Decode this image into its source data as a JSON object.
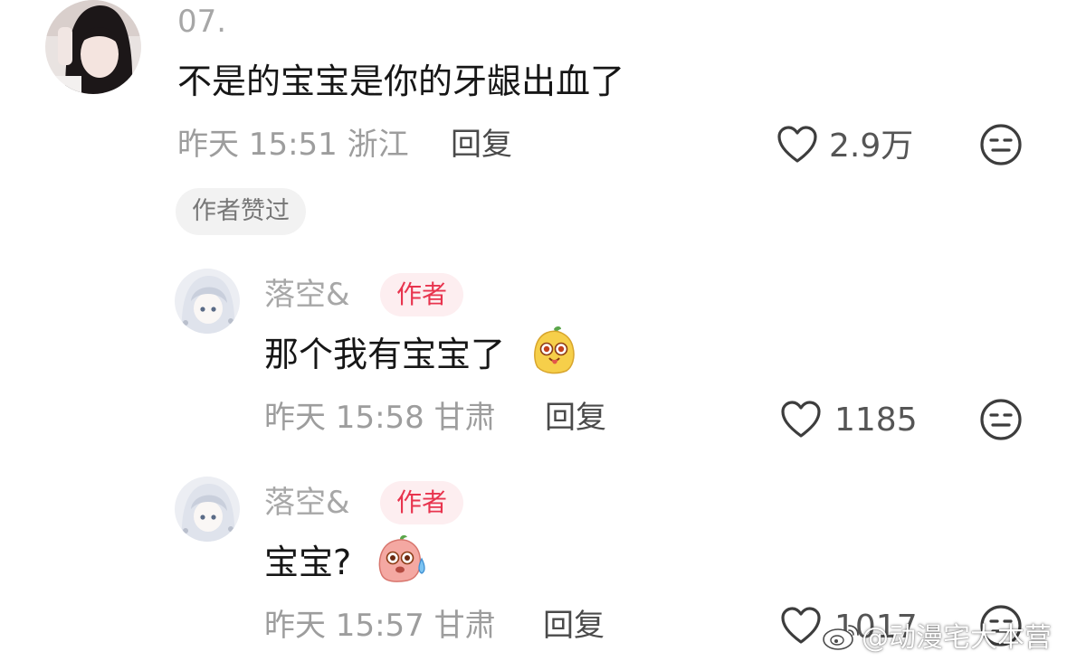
{
  "comment": {
    "username": "07.",
    "text": "不是的宝宝是你的牙龈出血了",
    "meta": "昨天 15:51 浙江",
    "reply_label": "回复",
    "like_count": "2.9万",
    "liked_by_author": "作者赞过",
    "replies": [
      {
        "username": "落空&",
        "badge": "作者",
        "text": "那个我有宝宝了",
        "emoji": "yellow-blob-tongue-emoji",
        "meta": "昨天 15:58 甘肃",
        "reply_label": "回复",
        "like_count": "1185"
      },
      {
        "username": "落空&",
        "badge": "作者",
        "text": "宝宝?",
        "emoji": "pink-blob-sweat-emoji",
        "meta": "昨天 15:57 甘肃",
        "reply_label": "回复",
        "like_count": "1017"
      }
    ]
  },
  "watermark": "@动漫宅大本营",
  "colors": {
    "author_badge_text": "#e8344e",
    "author_badge_bg": "#fdeef0",
    "meta_text": "#9d9d9d",
    "content_text": "#161616"
  }
}
